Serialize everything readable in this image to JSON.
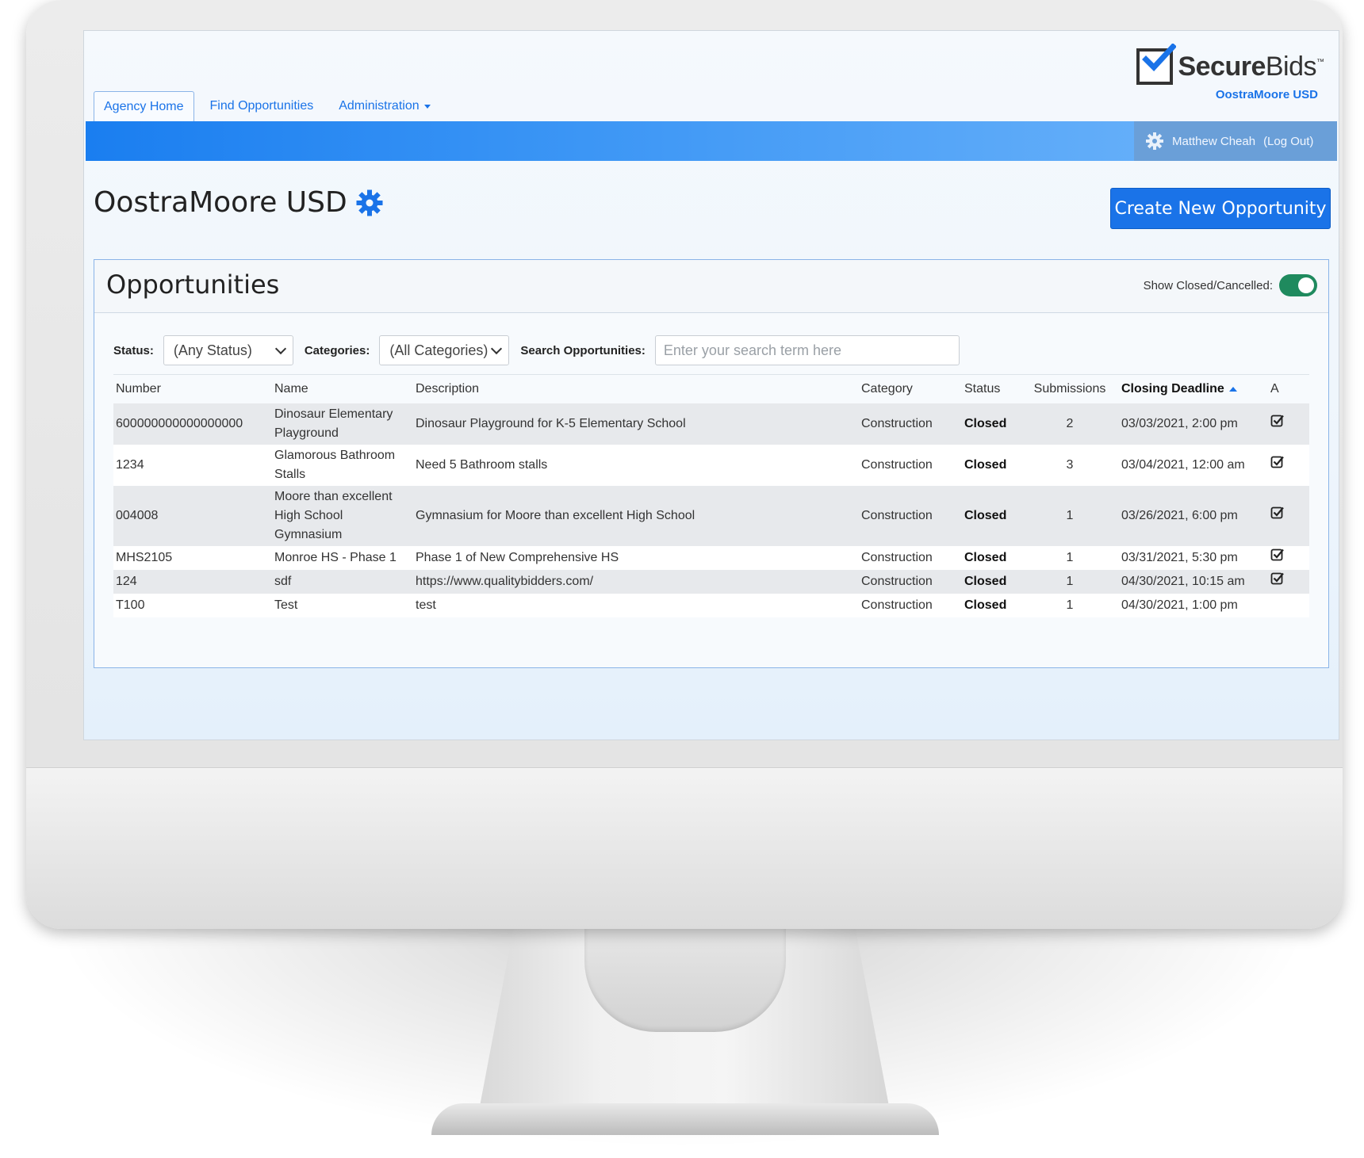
{
  "brand": {
    "logo_text_bold": "Secure",
    "logo_text_light": "Bids",
    "logo_tm": "™",
    "org": "OostraMoore USD"
  },
  "nav": {
    "tabs": [
      {
        "label": "Agency Home",
        "active": true
      },
      {
        "label": "Find Opportunities",
        "active": false
      },
      {
        "label": "Administration",
        "active": false
      }
    ]
  },
  "user": {
    "name": "Matthew Cheah",
    "logout": "(Log Out)"
  },
  "page": {
    "title": "OostraMoore USD",
    "create_button": "Create New Opportunity"
  },
  "panel": {
    "title": "Opportunities",
    "toggle_label": "Show Closed/Cancelled:",
    "toggle_on": true
  },
  "filters": {
    "status_label": "Status:",
    "status_value": "(Any Status)",
    "categories_label": "Categories:",
    "categories_value": "(All Categories)",
    "search_label": "Search Opportunities:",
    "search_placeholder": "Enter your search term here"
  },
  "table": {
    "columns": [
      "Number",
      "Name",
      "Description",
      "Category",
      "Status",
      "Submissions",
      "Closing Deadline",
      "A"
    ],
    "rows": [
      {
        "number": "600000000000000000",
        "name": "Dinosaur Elementary Playground",
        "description": "Dinosaur Playground for K-5 Elementary School",
        "category": "Construction",
        "status": "Closed",
        "submissions": "2",
        "deadline": "03/03/2021, 2:00 pm",
        "checked": true
      },
      {
        "number": "1234",
        "name": "Glamorous Bathroom Stalls",
        "description": "Need 5 Bathroom stalls",
        "category": "Construction",
        "status": "Closed",
        "submissions": "3",
        "deadline": "03/04/2021, 12:00 am",
        "checked": true
      },
      {
        "number": "004008",
        "name": "Moore than excellent High School Gymnasium",
        "description": "Gymnasium for Moore than excellent High School",
        "category": "Construction",
        "status": "Closed",
        "submissions": "1",
        "deadline": "03/26/2021, 6:00 pm",
        "checked": true
      },
      {
        "number": "MHS2105",
        "name": "Monroe HS - Phase 1",
        "description": "Phase 1 of New Comprehensive HS",
        "category": "Construction",
        "status": "Closed",
        "submissions": "1",
        "deadline": "03/31/2021, 5:30 pm",
        "checked": true
      },
      {
        "number": "124",
        "name": "sdf",
        "description": "https://www.qualitybidders.com/",
        "category": "Construction",
        "status": "Closed",
        "submissions": "1",
        "deadline": "04/30/2021, 10:15 am",
        "checked": true
      },
      {
        "number": "T100",
        "name": "Test",
        "description": "test",
        "category": "Construction",
        "status": "Closed",
        "submissions": "1",
        "deadline": "04/30/2021, 1:00 pm",
        "checked": false
      }
    ]
  },
  "colors": {
    "accent": "#1a73e8",
    "toggle_on": "#1f8a5e"
  }
}
